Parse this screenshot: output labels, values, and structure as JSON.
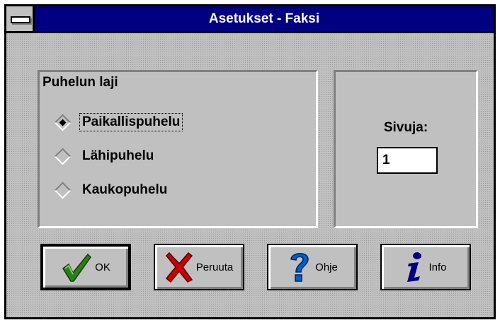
{
  "window": {
    "title": "Asetukset - Faksi"
  },
  "call_type": {
    "title": "Puhelun laji",
    "options": [
      {
        "label": "Paikallispuhelu",
        "selected": true
      },
      {
        "label": "Lähipuhelu",
        "selected": false
      },
      {
        "label": "Kaukopuhelu",
        "selected": false
      }
    ]
  },
  "pages": {
    "label": "Sivuja:",
    "value": "1"
  },
  "buttons": {
    "ok": {
      "label": "OK",
      "icon": "checkmark-icon"
    },
    "cancel": {
      "label": "Peruuta",
      "icon": "red-x-icon"
    },
    "help": {
      "label": "Ohje",
      "icon": "question-mark-icon"
    },
    "info": {
      "label": "Info",
      "icon": "info-icon"
    }
  },
  "colors": {
    "titlebar": "#000080",
    "face": "#c0c0c0",
    "ok_check": "#2e7d1a",
    "cancel_x": "#cc0000",
    "help_q": "#0060c0",
    "info_i": "#000080"
  }
}
